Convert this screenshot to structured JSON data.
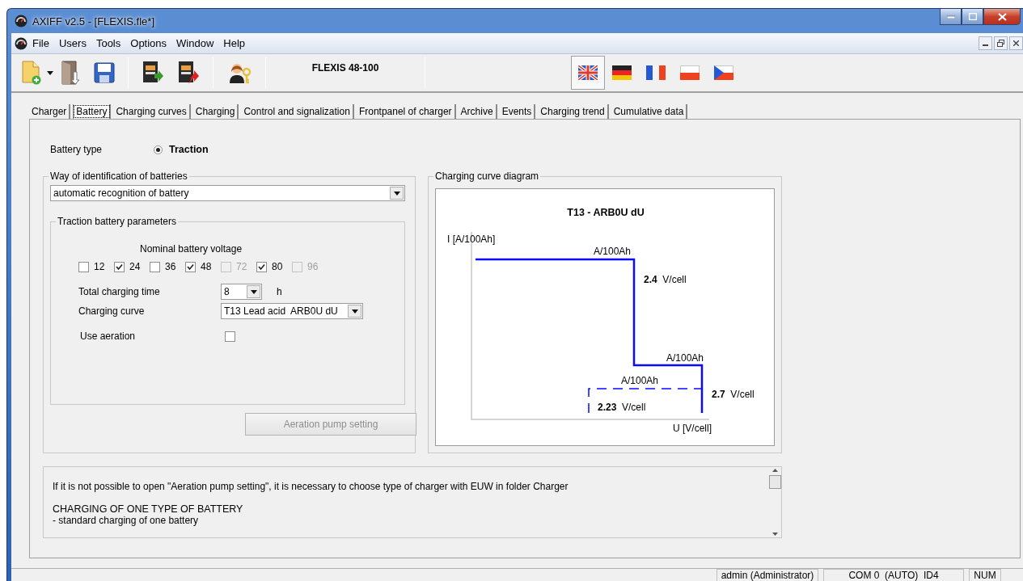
{
  "window": {
    "title": "AXIFF v2.5 - [FLEXIS.fle*]"
  },
  "menu": [
    "File",
    "Users",
    "Tools",
    "Options",
    "Window",
    "Help"
  ],
  "toolbar": {
    "device": "FLEXIS 48-100",
    "languages": [
      {
        "kind": "uk",
        "selected": true
      },
      {
        "kind": "de",
        "selected": false
      },
      {
        "kind": "fr",
        "selected": false
      },
      {
        "kind": "pl",
        "selected": false
      },
      {
        "kind": "cz",
        "selected": false
      }
    ]
  },
  "tabs": [
    {
      "label": "Charger",
      "selected": false
    },
    {
      "label": "Battery",
      "selected": true
    },
    {
      "label": "Charging curves",
      "selected": false
    },
    {
      "label": "Charging",
      "selected": false
    },
    {
      "label": "Control and signalization",
      "selected": false
    },
    {
      "label": "Frontpanel of charger",
      "selected": false
    },
    {
      "label": "Archive",
      "selected": false
    },
    {
      "label": "Events",
      "selected": false
    },
    {
      "label": "Charging trend",
      "selected": false
    },
    {
      "label": "Cumulative data",
      "selected": false
    }
  ],
  "battery_type": {
    "label": "Battery type",
    "option": "Traction",
    "selected": true
  },
  "identification": {
    "title": "Way of identification of batteries",
    "value": "automatic recognition of battery"
  },
  "parameters": {
    "title": "Traction battery parameters",
    "voltage_label": "Nominal battery voltage",
    "voltages": [
      {
        "label": "12",
        "checked": false,
        "disabled": false
      },
      {
        "label": "24",
        "checked": true,
        "disabled": false
      },
      {
        "label": "36",
        "checked": false,
        "disabled": false
      },
      {
        "label": "48",
        "checked": true,
        "disabled": false
      },
      {
        "label": "72",
        "checked": false,
        "disabled": true
      },
      {
        "label": "80",
        "checked": true,
        "disabled": false
      },
      {
        "label": "96",
        "checked": false,
        "disabled": true
      }
    ],
    "charging_time": {
      "label": "Total charging time",
      "value": "8",
      "unit": "h"
    },
    "charging_curve": {
      "label": "Charging curve",
      "value": "T13 Lead acid  ARB0U dU"
    },
    "aeration": {
      "label": "Use aeration",
      "checked": false
    }
  },
  "pump_button": {
    "label": "Aeration pump setting",
    "disabled": true
  },
  "diagram": {
    "title": "Charging curve diagram",
    "heading": "T13 - ARB0U dU",
    "y_axis": "I [A/100Ah]",
    "x_axis": "U [V/cell]",
    "labels": [
      {
        "text": "A/100Ah"
      },
      {
        "text": "**2.4**  V/cell"
      },
      {
        "text": "A/100Ah"
      },
      {
        "text": "A/100Ah"
      },
      {
        "text": "**2.7**  V/cell"
      },
      {
        "text": "**2.23**  V/cell"
      }
    ]
  },
  "info": {
    "lines": [
      "If it is not possible to open \"Aeration pump setting\", it is necessary to choose type of charger with EUW in folder Charger",
      "CHARGING OF ONE TYPE OF BATTERY",
      "- standard charging of one battery"
    ]
  },
  "status_bar": [
    "admin (Administrator)",
    "COM 0  (AUTO)  ID4",
    "NUM"
  ]
}
